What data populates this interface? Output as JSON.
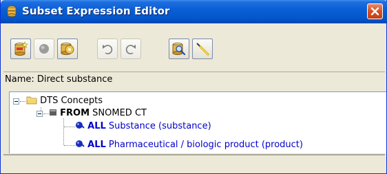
{
  "window": {
    "title": "Subset Expression Editor"
  },
  "toolbar": {
    "buttons": [
      {
        "icon": "new-expression-icon"
      },
      {
        "icon": "record-icon"
      },
      {
        "icon": "database-icon"
      },
      {
        "icon": "undo-icon"
      },
      {
        "icon": "redo-icon"
      },
      {
        "icon": "inspect-icon"
      },
      {
        "icon": "edit-tool-icon"
      }
    ]
  },
  "name": {
    "label": "Name: Direct substance"
  },
  "tree": {
    "root": {
      "label": "DTS Concepts"
    },
    "from": {
      "keyword": "FROM",
      "label": "SNOMED CT"
    },
    "items": [
      {
        "keyword": "ALL",
        "label": "Substance (substance)"
      },
      {
        "keyword": "ALL",
        "label": "Pharmaceutical / biologic product (product)"
      }
    ]
  },
  "colors": {
    "titlebar": "#0a5fd6",
    "close": "#d6501f",
    "link": "#0000cc",
    "face": "#ece9d8"
  }
}
